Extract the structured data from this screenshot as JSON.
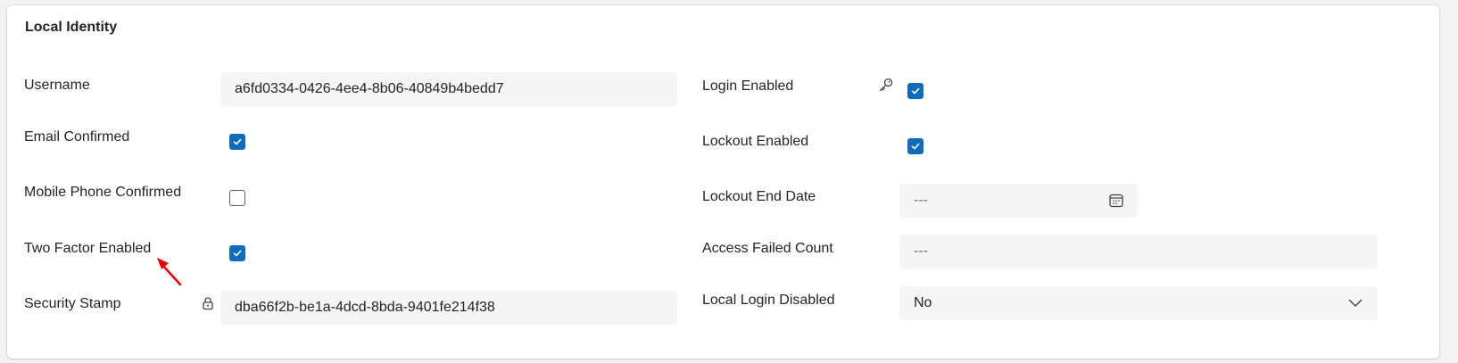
{
  "section": {
    "title": "Local Identity"
  },
  "fields": {
    "username": {
      "label": "Username",
      "value": "a6fd0334-0426-4ee4-8b06-40849b4bedd7"
    },
    "email_confirmed": {
      "label": "Email Confirmed",
      "checked": true
    },
    "mobile_phone_confirmed": {
      "label": "Mobile Phone Confirmed",
      "checked": false
    },
    "two_factor_enabled": {
      "label": "Two Factor Enabled",
      "checked": true
    },
    "security_stamp": {
      "label": "Security Stamp",
      "value": "dba66f2b-be1a-4dcd-8bda-9401fe214f38"
    },
    "login_enabled": {
      "label": "Login Enabled",
      "checked": true
    },
    "lockout_enabled": {
      "label": "Lockout Enabled",
      "checked": true
    },
    "lockout_end_date": {
      "label": "Lockout End Date",
      "value": "---"
    },
    "access_failed_count": {
      "label": "Access Failed Count",
      "value": "---"
    },
    "local_login_disabled": {
      "label": "Local Login Disabled",
      "value": "No"
    }
  },
  "icons": {
    "security_stamp": "lock-icon",
    "login_enabled": "key-icon",
    "lockout_end_date": "calendar-icon",
    "local_login_disabled": "chevron-down-icon",
    "annotation": "red-arrow-annotation"
  },
  "colors": {
    "accent": "#0f6cbd",
    "annotation": "#e60000",
    "field_bg": "#f5f5f5"
  }
}
